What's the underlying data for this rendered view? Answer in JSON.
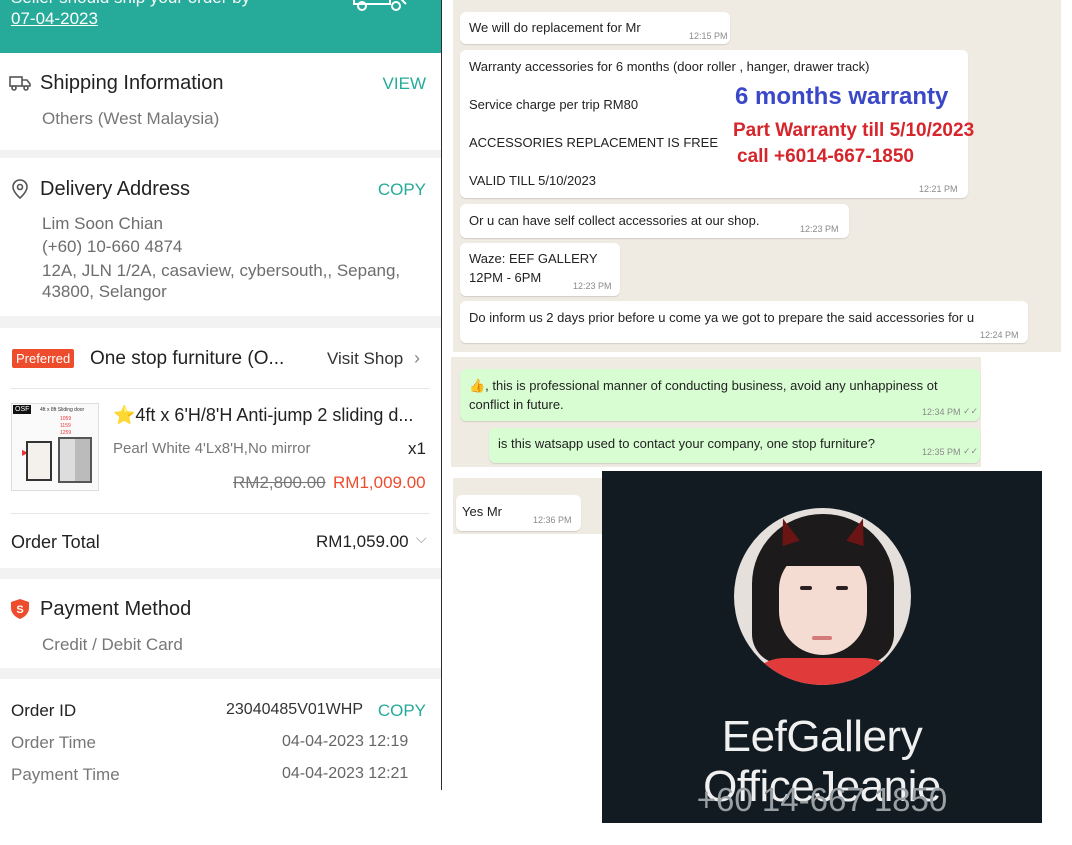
{
  "order": {
    "ship_line": "Seller should ship your order by",
    "ship_date": "07-04-2023",
    "shipping": {
      "title": "Shipping Information",
      "action": "VIEW",
      "value": "Others (West Malaysia)"
    },
    "delivery": {
      "title": "Delivery Address",
      "action": "COPY",
      "name": "Lim Soon Chian",
      "phone": "(+60) 10-660 4874",
      "address_1": "12A, JLN 1/2A, casaview, cybersouth,, Sepang,",
      "address_2": "43800, Selangor"
    },
    "shop": {
      "badge": "Preferred",
      "name": "One stop furniture (O...",
      "visit": "Visit Shop"
    },
    "product": {
      "title": "⭐4ft x 6'H/8'H Anti-jump 2 sliding d...",
      "variant": "Pearl White 4'Lx8'H,No mirror",
      "qty": "x1",
      "original_price": "RM2,800.00",
      "price": "RM1,009.00",
      "thumb_badge": "OSF"
    },
    "total": {
      "label": "Order Total",
      "value": "RM1,059.00"
    },
    "payment": {
      "title": "Payment Method",
      "value": "Credit / Debit Card"
    },
    "ids": {
      "order_id_label": "Order ID",
      "order_id": "23040485V01WHP",
      "copy": "COPY",
      "order_time_label": "Order Time",
      "order_time": "04-04-2023 12:19",
      "payment_time_label": "Payment Time",
      "payment_time": "04-04-2023 12:21"
    }
  },
  "chat": {
    "m1": {
      "text": "We will do replacement for Mr",
      "time": "12:15 PM"
    },
    "m2": {
      "l1": "Warranty accessories for 6 months (door roller , hanger, drawer track)",
      "l2": "Service charge per trip RM80",
      "l3": "ACCESSORIES REPLACEMENT IS FREE",
      "l4": "VALID TILL 5/10/2023",
      "time": "12:21 PM"
    },
    "m3": {
      "text": "Or u can have self collect accessories at our shop.",
      "time": "12:23 PM"
    },
    "m4": {
      "l1": "Waze: EEF GALLERY",
      "l2": "12PM - 6PM",
      "time": "12:23 PM"
    },
    "m5": {
      "text": "Do inform us 2 days prior before u come ya we got to prepare the said accessories for u",
      "time": "12:24 PM"
    },
    "overlay": {
      "blue": "6 months warranty",
      "red1": "Part Warranty till 5/10/2023",
      "red2": "call +6014-667-1850"
    },
    "s1": {
      "l1": "👍, this is professional manner of conducting business, avoid any unhappiness ot",
      "l2": "conflict in future.",
      "time": "12:34 PM"
    },
    "s2": {
      "text": "is this watsapp used to contact your company, one stop furniture?",
      "time": "12:35 PM"
    },
    "r1": {
      "text": "Yes Mr",
      "time": "12:36 PM"
    }
  },
  "profile": {
    "name": "EefGallery OfficeJeanie",
    "phone": "+60 14-667 1850"
  },
  "colors": {
    "teal": "#26aa99",
    "orange": "#ee4d2d",
    "chat_bg": "#efeae2",
    "sent_bubble": "#d9fdd3",
    "card_bg": "#111b21"
  }
}
